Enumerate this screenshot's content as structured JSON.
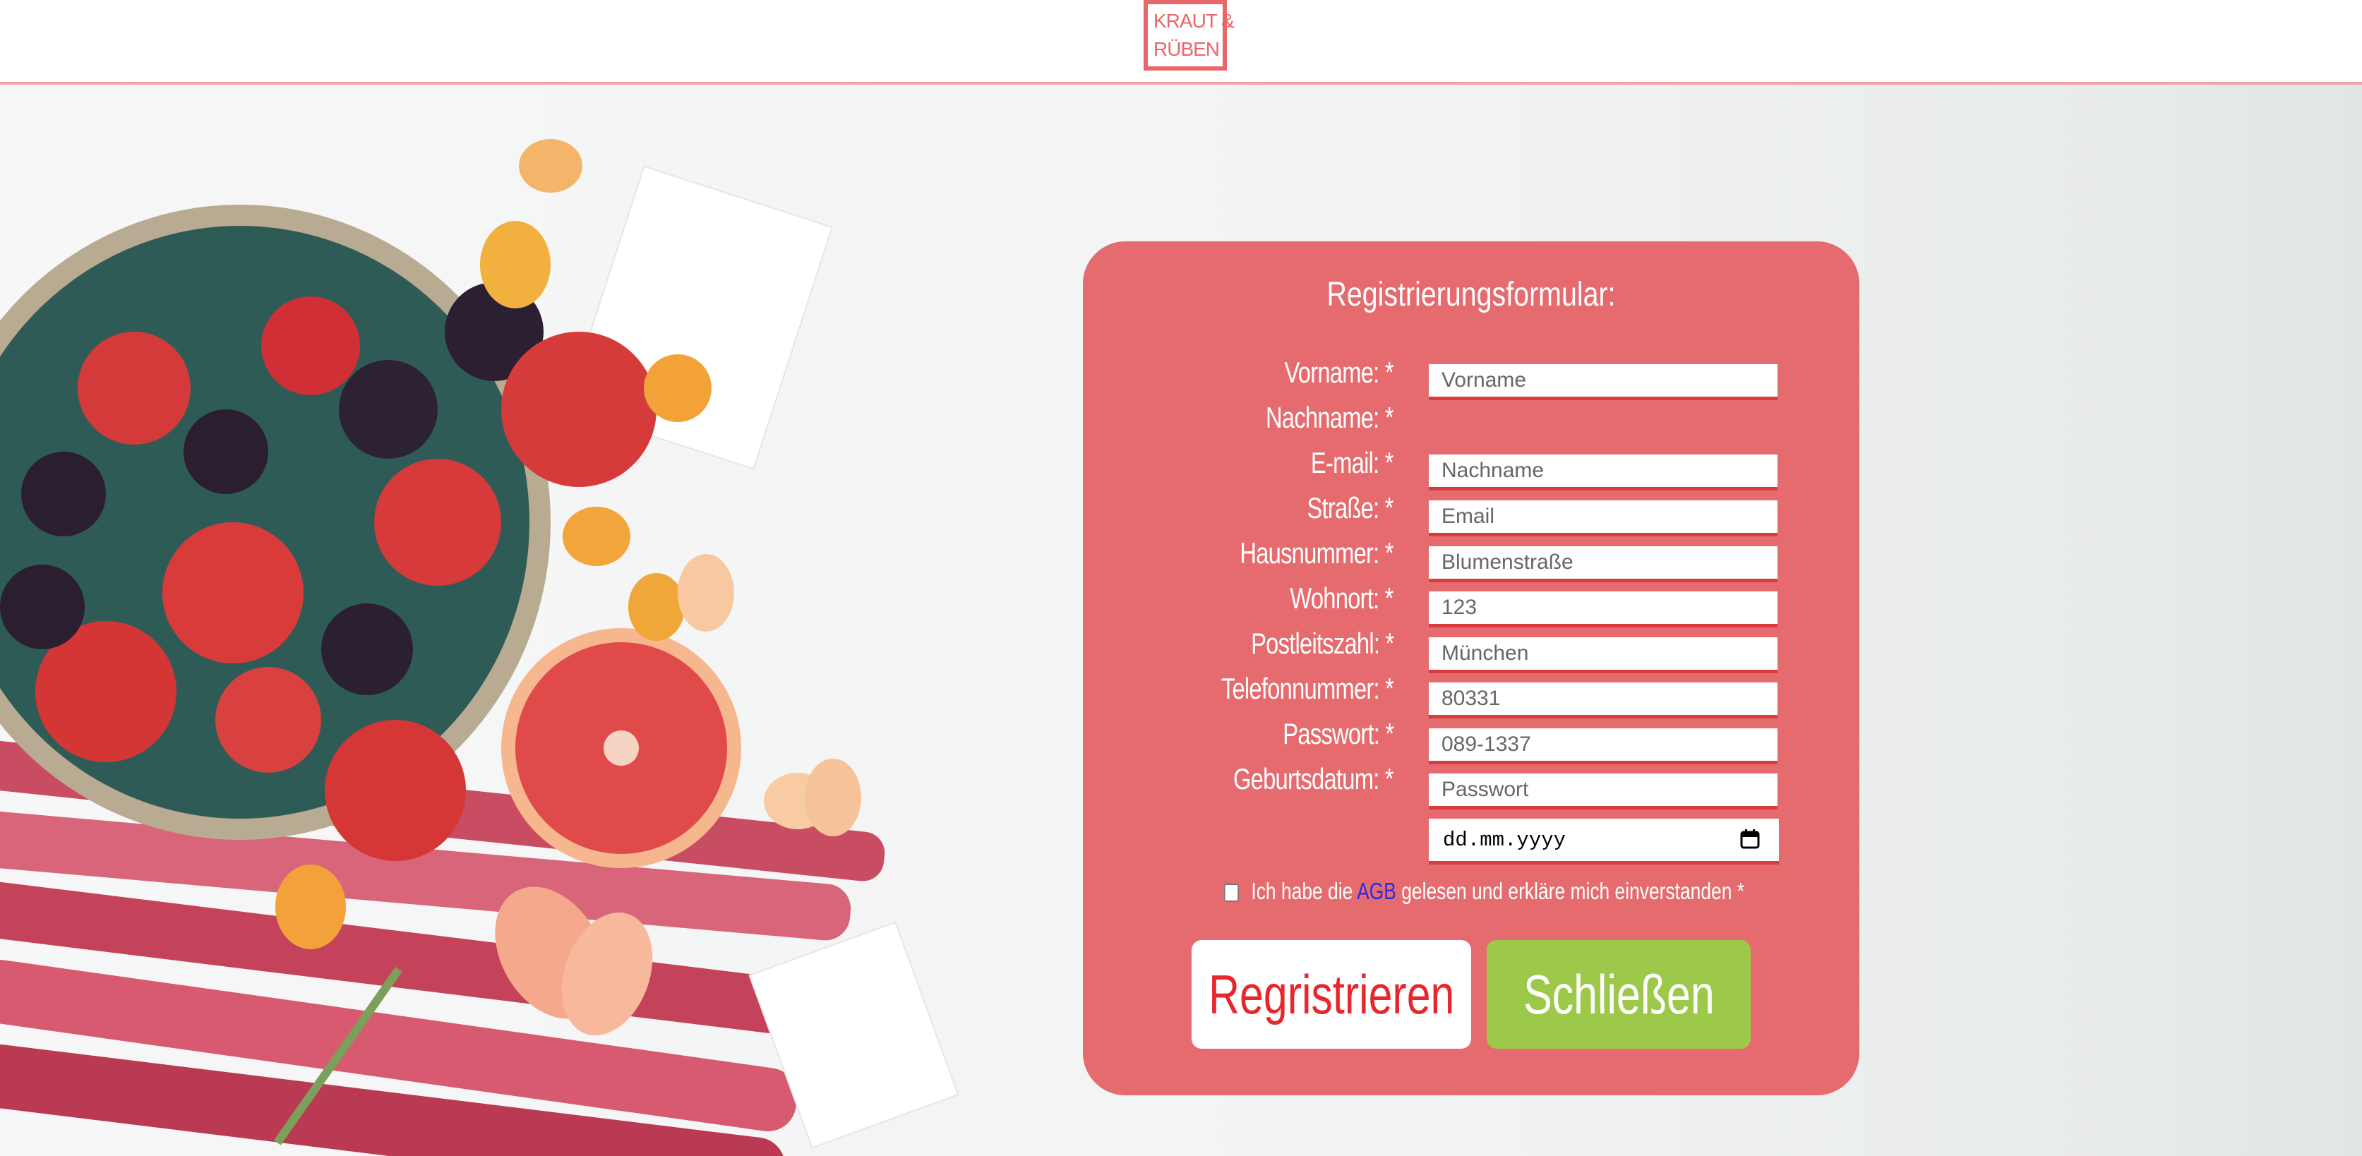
{
  "header": {
    "logo_line1": "KRAUT &",
    "logo_line2": "RÜBEN"
  },
  "form": {
    "title": "Registrierungsformular:",
    "labels": [
      "Vorname: *",
      "Nachname: *",
      "E-mail: *",
      "Straße: *",
      "Hausnummer: *",
      "Wohnort: *",
      "Postleitszahl: *",
      "Telefonnummer: *",
      "Passwort: *",
      "Geburtsdatum: *"
    ],
    "placeholders": [
      "Vorname",
      "Nachname",
      "Email",
      "Blumenstraße",
      "123",
      "München",
      "80331",
      "089-1337",
      "Passwort"
    ],
    "date_placeholder": "dd.mm.yyyy",
    "agb_text_before": "Ich habe die",
    "agb_link": "AGB",
    "agb_text_after": "gelesen und erkläre mich einverstanden *",
    "register_label": "Regristrieren",
    "close_label": "Schließen"
  },
  "colors": {
    "card": "#e56b6f",
    "accent_red": "#e8262b",
    "close_green": "#9dc94a",
    "logo": "#e8676b"
  },
  "icons": [
    "calendar-icon",
    "checkbox"
  ]
}
